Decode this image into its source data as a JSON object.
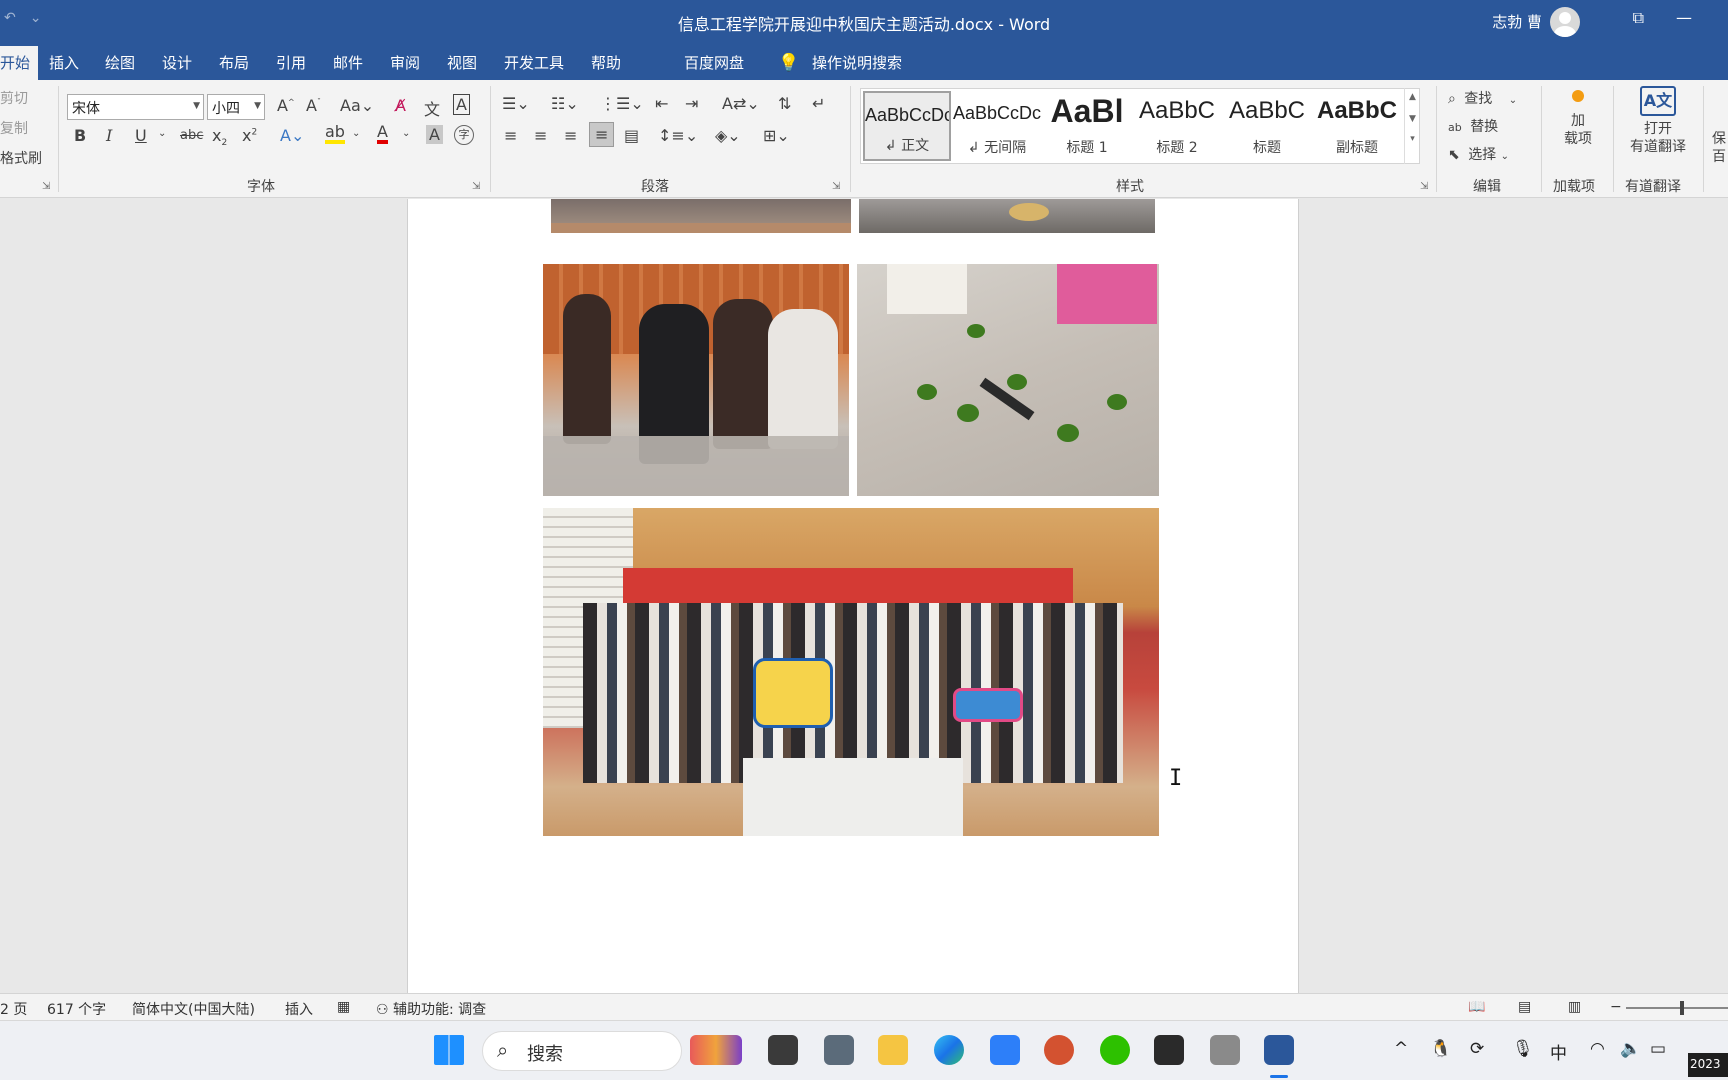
{
  "window": {
    "title": "信息工程学院开展迎中秋国庆主题活动.docx  -  Word",
    "user": "志勃 曹"
  },
  "tabs": [
    "开始",
    "插入",
    "绘图",
    "设计",
    "布局",
    "引用",
    "邮件",
    "审阅",
    "视图",
    "开发工具",
    "帮助",
    "百度网盘"
  ],
  "tell_me": "操作说明搜索",
  "clipboard": {
    "cut": "剪切",
    "copy": "复制",
    "painter": "格式刷"
  },
  "font": {
    "name": "宋体",
    "size": "小四",
    "group_label": "字体"
  },
  "paragraph": {
    "group_label": "段落"
  },
  "styles": {
    "group_label": "样式",
    "items": [
      {
        "sample": "AaBbCcDc",
        "name": "↲ 正文"
      },
      {
        "sample": "AaBbCcDc",
        "name": "↲ 无间隔"
      },
      {
        "sample": "AaBl",
        "name": "标题 1"
      },
      {
        "sample": "AaBbC",
        "name": "标题 2"
      },
      {
        "sample": "AaBbC",
        "name": "标题"
      },
      {
        "sample": "AaBbC",
        "name": "副标题"
      }
    ]
  },
  "editing": {
    "find": "查找",
    "replace": "替换",
    "select": "选择",
    "group_label": "编辑"
  },
  "addins": {
    "label": "加\n载项",
    "group_label": "加载项"
  },
  "youdao": {
    "label": "打开\n有道翻译",
    "group_label": "有道翻译"
  },
  "baidu_partial": "保\n百",
  "status": {
    "page": "2 页",
    "words": "617 个字",
    "language": "简体中文(中国大陆)",
    "mode": "插入",
    "accessibility": "辅助功能: 调查"
  },
  "taskbar": {
    "search_placeholder": "搜索",
    "ime": "中",
    "clock": "2023"
  },
  "colors": {
    "word_blue": "#2b579a",
    "ribbon_bg": "#f3f3f3"
  }
}
